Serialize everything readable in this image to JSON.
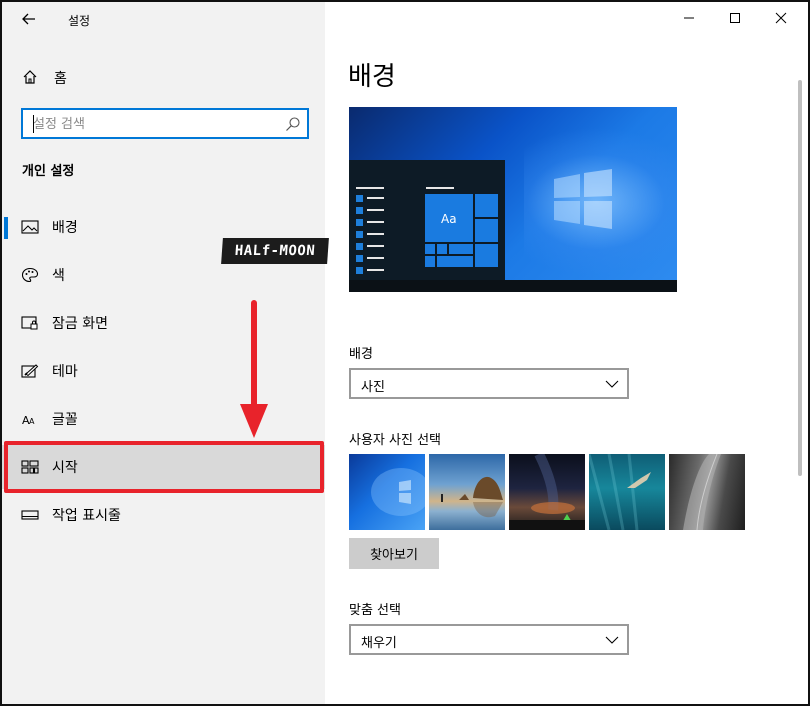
{
  "window": {
    "app_title": "설정",
    "page_title": "배경"
  },
  "sidebar": {
    "home_label": "홈",
    "search_placeholder": "설정 검색",
    "section_title": "개인 설정",
    "items": [
      {
        "label": "배경",
        "icon": "picture-icon",
        "active": true
      },
      {
        "label": "색",
        "icon": "palette-icon"
      },
      {
        "label": "잠금 화면",
        "icon": "lock-screen-icon"
      },
      {
        "label": "테마",
        "icon": "theme-brush-icon"
      },
      {
        "label": "글꼴",
        "icon": "font-icon"
      },
      {
        "label": "시작",
        "icon": "start-tiles-icon",
        "highlighted": true
      },
      {
        "label": "작업 표시줄",
        "icon": "taskbar-icon"
      }
    ]
  },
  "watermark": "HALf-MOON",
  "preview": {
    "tile_text": "Aa"
  },
  "background": {
    "label": "배경",
    "value": "사진"
  },
  "photo_picker": {
    "label": "사용자 사진 선택",
    "browse_label": "찾아보기",
    "thumbnails": [
      "windows-blue-thumbnail",
      "beach-rock-thumbnail",
      "night-sky-tent-thumbnail",
      "underwater-swimmer-thumbnail",
      "rock-cliff-thumbnail"
    ]
  },
  "fit": {
    "label": "맞춤 선택",
    "value": "채우기"
  },
  "colors": {
    "accent": "#0078d7",
    "highlight": "#e8232b"
  }
}
